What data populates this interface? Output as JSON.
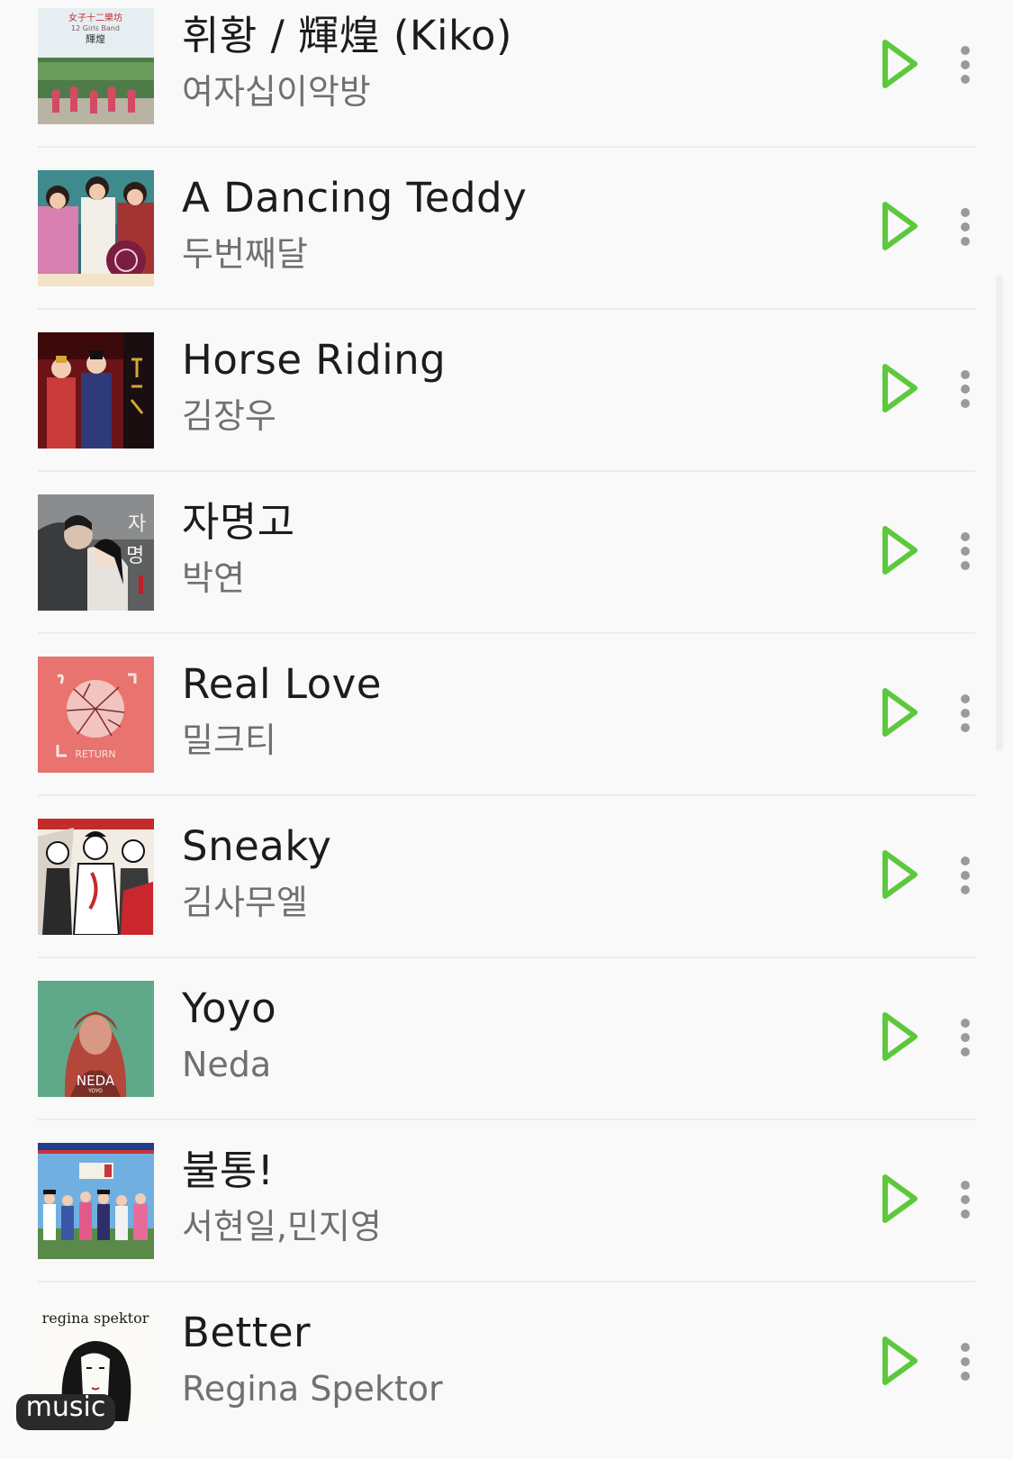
{
  "accent_color": "#5cc93c",
  "songs": [
    {
      "title": "휘황 / 輝煌 (Kiko)",
      "artist": "여자십이악방",
      "cover_icon": "album-cover-12-girls-band"
    },
    {
      "title": "A Dancing Teddy",
      "artist": "두번째달",
      "cover_icon": "album-cover-drama-ost"
    },
    {
      "title": "Horse Riding",
      "artist": "김장우",
      "cover_icon": "album-cover-historical-drama"
    },
    {
      "title": "자명고",
      "artist": "박연",
      "cover_icon": "album-cover-jamyeonggo"
    },
    {
      "title": "Real Love",
      "artist": "밀크티",
      "cover_icon": "album-cover-return"
    },
    {
      "title": "Sneaky",
      "artist": "김사무엘",
      "cover_icon": "album-cover-comic-art"
    },
    {
      "title": "Yoyo",
      "artist": "Neda",
      "cover_icon": "album-cover-neda"
    },
    {
      "title": "불통!",
      "artist": "서현일,민지영",
      "cover_icon": "album-cover-hanbok-drama"
    },
    {
      "title": "Better",
      "artist": "Regina Spektor",
      "cover_icon": "album-cover-regina-spektor"
    }
  ],
  "cover_texts": {
    "girls_band_line1": "女子十二樂坊",
    "girls_band_line2": "12 Girls Band",
    "girls_band_line3": "輝煌",
    "return_text": "RETURN",
    "neda_name": "NEDA",
    "neda_sub": "YOYO",
    "regina_name": "regina spektor"
  },
  "bottom_tab": {
    "label": "music"
  }
}
